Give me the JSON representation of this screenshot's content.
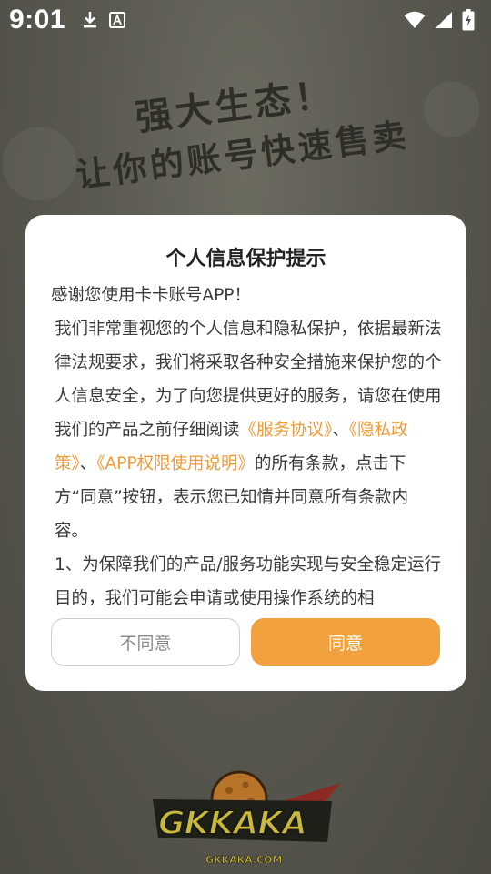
{
  "status_bar": {
    "time": "9:01",
    "left_icons": [
      "download-icon",
      "font-a-icon"
    ],
    "right_icons": [
      "wifi-icon",
      "signal-icon",
      "battery-charging-icon"
    ]
  },
  "splash": {
    "slogan_line1": "强大生态！",
    "slogan_line2": "让你的账号快速售卖",
    "logo_text": "GKKAKA",
    "logo_subtext": "GKKAKA.COM"
  },
  "dialog": {
    "title": "个人信息保护提示",
    "greeting": "感谢您使用卡卡账号APP！",
    "para1_part1": " 我们非常重视您的个人信息和隐私保护，依据最新法律法规要求，我们将采取各种安全措施来保护您的个人信息安全，为了向您提供更好的服务，请您在使用我们的产品之前仔细阅读",
    "link_service": "《服务协议》",
    "sep1": "、",
    "link_privacy": "《隐私政策》",
    "sep2": "、",
    "link_permission": "《APP权限使用说明》",
    "para1_part2": "的所有条款，点击下方“同意”按钮，表示您已知情并同意所有条款内容。",
    "para2": " 1、为保障我们的产品/服务功能实现与安全稳定运行目的，我们可能会申请或使用操作系统的相",
    "disagree_label": "不同意",
    "agree_label": "同意"
  },
  "colors": {
    "accent": "#f3a03f",
    "link": "#f19b35",
    "overlay_bg": "#4f4f47"
  }
}
